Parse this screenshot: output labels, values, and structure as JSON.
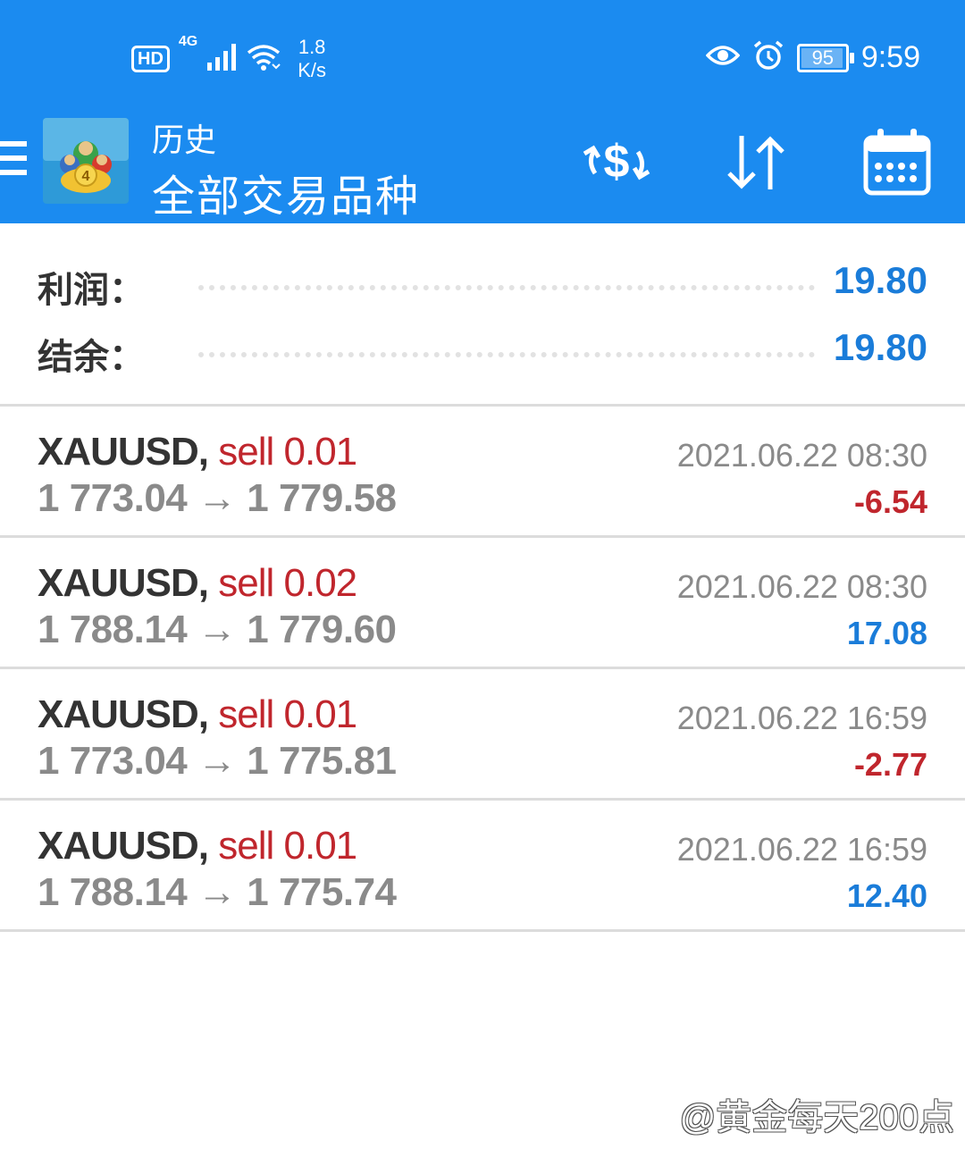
{
  "status_bar": {
    "hd": "HD",
    "network_type": "4G",
    "speed_value": "1.8",
    "speed_unit": "K/s",
    "battery": "95",
    "time": "9:59",
    "icons": [
      "signal-icon",
      "wifi-icon",
      "eye-icon",
      "alarm-icon",
      "battery-icon"
    ]
  },
  "toolbar": {
    "subtitle": "历史",
    "title": "全部交易品种",
    "icons": [
      "menu-icon",
      "app-logo",
      "dollar-exchange-icon",
      "sort-icon",
      "calendar-icon"
    ]
  },
  "summary": {
    "profit_label": "利润：",
    "profit_value": "19.80",
    "balance_label": "结余：",
    "balance_value": "19.80"
  },
  "deals": [
    {
      "symbol": "XAUUSD,",
      "side": "sell 0.01",
      "open": "1 773.04",
      "arrow": "→",
      "close": "1 779.58",
      "time": "2021.06.22 08:30",
      "profit": "-6.54"
    },
    {
      "symbol": "XAUUSD,",
      "side": "sell 0.02",
      "open": "1 788.14",
      "arrow": "→",
      "close": "1 779.60",
      "time": "2021.06.22 08:30",
      "profit": "17.08"
    },
    {
      "symbol": "XAUUSD,",
      "side": "sell 0.01",
      "open": "1 773.04",
      "arrow": "→",
      "close": "1 775.81",
      "time": "2021.06.22 16:59",
      "profit": "-2.77"
    },
    {
      "symbol": "XAUUSD,",
      "side": "sell 0.01",
      "open": "1 788.14",
      "arrow": "→",
      "close": "1 775.74",
      "time": "2021.06.22 16:59",
      "profit": "12.40"
    }
  ],
  "watermark": "@黄金每天200点",
  "colors": {
    "header": "#1b8bf0",
    "positive": "#1a7cd9",
    "negative": "#c0262d",
    "muted": "#8a8a8a"
  }
}
